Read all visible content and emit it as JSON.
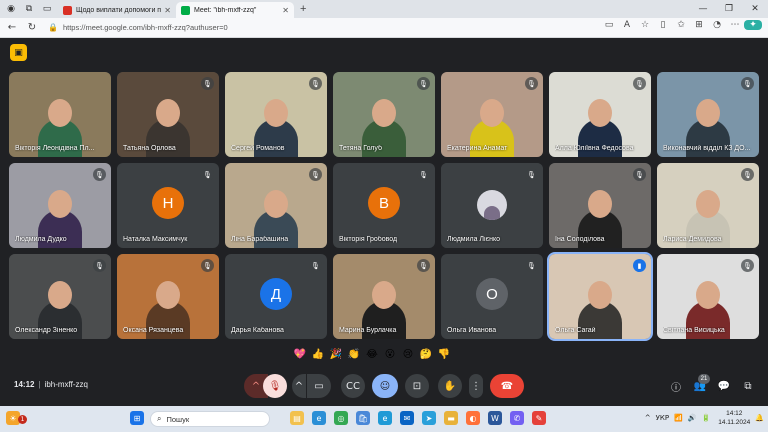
{
  "browser": {
    "tabs": [
      {
        "title": "Щодо виплати допомоги при п...",
        "active": false,
        "fav_color": "#d93025"
      },
      {
        "title": "Meet: \"ibh-mxff-zzq\"",
        "active": true,
        "fav_color": "#00ac47"
      }
    ],
    "url": "https://meet.google.com/ibh-mxff-zzq?authuser=0",
    "new_tab_label": "+",
    "window_controls": [
      "—",
      "❐",
      "✕"
    ]
  },
  "meet": {
    "meeting_time": "14:12",
    "meeting_code": "ibh-mxff-zzq",
    "participant_count": "21",
    "participants": [
      {
        "name": "Вікторія Леонідівна Пл...",
        "video": true,
        "bg": "#8a7a5c",
        "shirt": "#2f6b4a",
        "muted": false
      },
      {
        "name": "Татьяна Орлова",
        "video": true,
        "bg": "#5a4a3c",
        "shirt": "#3b3530",
        "muted": true
      },
      {
        "name": "Сергей Романов",
        "video": true,
        "bg": "#c9c2a4",
        "shirt": "#2d3b4a",
        "muted": true
      },
      {
        "name": "Тетяна Голуб",
        "video": true,
        "bg": "#7d8a72",
        "shirt": "#3a5e3a",
        "muted": true
      },
      {
        "name": "Екатерина Анамат",
        "video": true,
        "bg": "#b49a88",
        "shirt": "#d8c21a",
        "muted": true
      },
      {
        "name": "Алла Юліївна Федосова",
        "video": true,
        "bg": "#dcdcd4",
        "shirt": "#1d2c44",
        "muted": true
      },
      {
        "name": "Виконавчий відділ КЗ ДО...",
        "video": true,
        "bg": "#7b95a8",
        "shirt": "#2d3a44",
        "muted": true
      },
      {
        "name": "Людмила Дудко",
        "video": true,
        "bg": "#9c9ca4",
        "shirt": "#3c2e54",
        "muted": true
      },
      {
        "name": "Наталка Максимчук",
        "video": false,
        "initial": "Н",
        "avatar_color": "#e8710a",
        "muted": true
      },
      {
        "name": "Ліна Барабашина",
        "video": true,
        "bg": "#b9a88d",
        "shirt": "#3a4a56",
        "muted": true
      },
      {
        "name": "Вікторія Гробовод",
        "video": false,
        "initial": "В",
        "avatar_color": "#e8710a",
        "muted": true
      },
      {
        "name": "Людмила Лієнко",
        "video": true,
        "bg": "#3c4043",
        "shirt": "#7a6e88",
        "muted": true,
        "small": true
      },
      {
        "name": "Іна Солоділова",
        "video": true,
        "bg": "#6d6a68",
        "shirt": "#212121",
        "muted": true
      },
      {
        "name": "Лариса Демидова",
        "video": true,
        "bg": "#d6d0bf",
        "shirt": "#c7c3b4",
        "muted": true
      },
      {
        "name": "Олександр Зіненко",
        "video": true,
        "bg": "#4b4d4e",
        "shirt": "#2b2e31",
        "muted": true
      },
      {
        "name": "Оксана Рязанцева",
        "video": true,
        "bg": "#b8723a",
        "shirt": "#5a3a24",
        "muted": true
      },
      {
        "name": "Дарья Кабанова",
        "video": false,
        "initial": "Д",
        "avatar_color": "#1a73e8",
        "muted": true
      },
      {
        "name": "Марина Бурлачка",
        "video": true,
        "bg": "#a48b6b",
        "shirt": "#1f1f1f",
        "muted": true
      },
      {
        "name": "Ольга Иванова",
        "video": false,
        "initial": "О",
        "avatar_color": "#5f6368",
        "muted": true
      },
      {
        "name": "Ольга Сагай",
        "video": true,
        "bg": "#d8c7b4",
        "shirt": "#3b3936",
        "muted": false,
        "speaking": true,
        "active": true
      },
      {
        "name": "Світлана Висицька",
        "video": true,
        "bg": "#dedede",
        "shirt": "#7a2a2a",
        "muted": true
      }
    ],
    "reactions": [
      "💖",
      "👍",
      "🎉",
      "👏",
      "😂",
      "😮",
      "😢",
      "🤔",
      "👎"
    ]
  },
  "taskbar": {
    "search_placeholder": "Пошук",
    "language": "УКР",
    "time": "14:12",
    "date": "14.11.2024",
    "notification_count": "1"
  }
}
